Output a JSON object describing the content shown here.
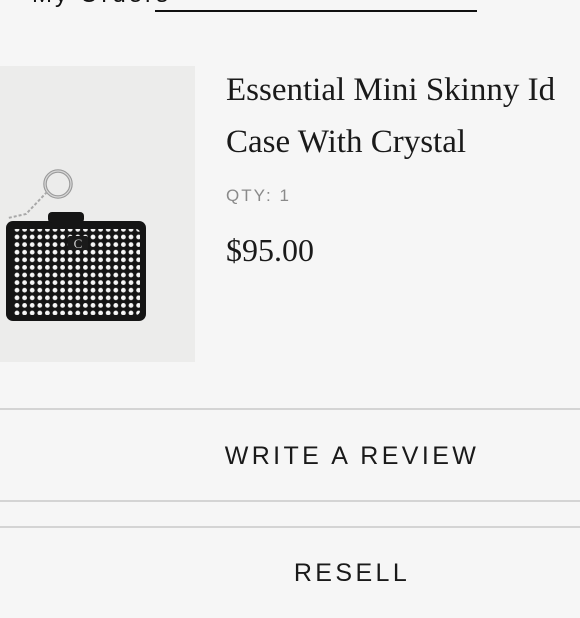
{
  "header": {
    "tab_text": "My Orders"
  },
  "product": {
    "image_icon": "crystal-card-case-image",
    "title_line1": "Essential Mini Skinny Id",
    "title_line2": "Case With Crystal",
    "qty": "QTY: 1",
    "price": "$95.00"
  },
  "actions": {
    "write_review": "WRITE A REVIEW",
    "resell": "RESELL"
  },
  "colors": {
    "background": "#f6f6f6",
    "text": "#1a1a1a",
    "muted": "#8a8a8a",
    "divider": "#d4d4d4"
  }
}
